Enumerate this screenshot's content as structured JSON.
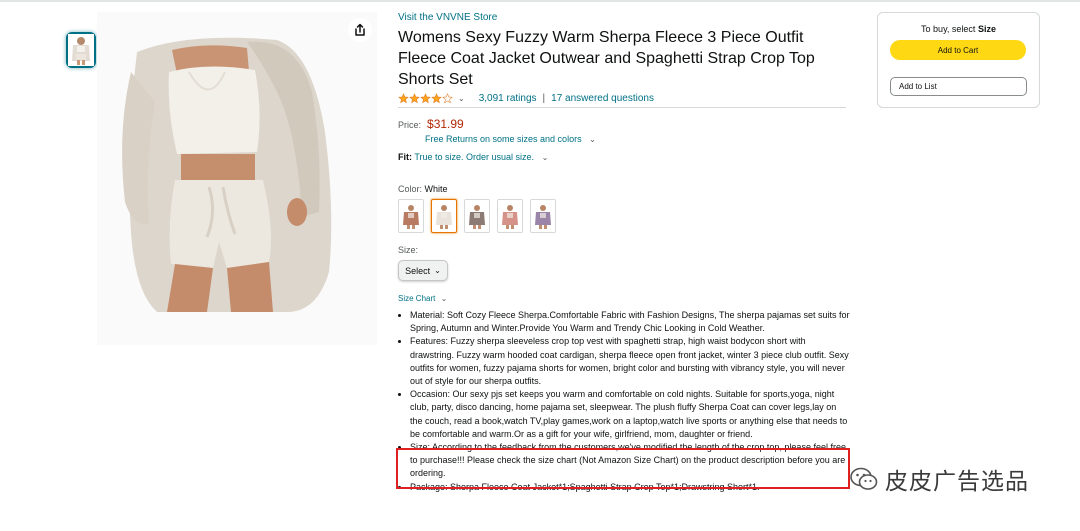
{
  "store_link": "Visit the VNVNE Store",
  "title": "Womens Sexy Fuzzy Warm Sherpa Fleece 3 Piece Outfit Fleece Coat Jacket Outwear and Spaghetti Strap Crop Top Shorts Set",
  "rating": {
    "stars": 4.0,
    "ratings": "3,091 ratings",
    "separator": "|",
    "questions": "17 answered questions"
  },
  "price": {
    "label": "Price:",
    "value": "$31.99",
    "returns": "Free Returns on some sizes and colors"
  },
  "fit": {
    "label": "Fit:",
    "text": "True to size. Order usual size."
  },
  "color": {
    "label": "Color:",
    "value": "White",
    "swatch_colors": [
      "#b97a62",
      "#e9e3dc",
      "#8c7b74",
      "#d49288",
      "#9a85a8"
    ],
    "selected_index": 1
  },
  "size": {
    "label": "Size:",
    "select_value": "Select"
  },
  "size_chart": "Size Chart",
  "bullets": [
    "Material: Soft Cozy Fleece Sherpa.Comfortable Fabric with Fashion Designs, The sherpa pajamas set suits for Spring, Autumn and Winter.Provide You Warm and Trendy Chic Looking in Cold Weather.",
    "Features: Fuzzy sherpa sleeveless crop top vest with spaghetti strap, high waist bodycon short with drawstring. Fuzzy warm hooded coat cardigan, sherpa fleece open front jacket, winter 3 piece club outfit. Sexy outfits for women, fuzzy pajama shorts for women, bright color and bursting with vibrancy style, you will never out of style for our sherpa outfits.",
    "Occasion: Our sexy pjs set keeps you warm and comfortable on cold nights. Suitable for sports,yoga, night club, party, disco dancing, home pajama set, sleepwear. The plush fluffy Sherpa Coat can cover legs,lay on the couch, read a book,watch TV,play games,work on a laptop,watch live sports or anything else that needs to be comfortable and warm.Or as a gift for your wife, girlfriend, mom, daughter or friend.",
    "Size: According to the feedback from the customers,we've modified the length of the crop top, please feel free to purchase!!! Please check the size chart (Not Amazon Size Chart) on the product description before you are ordering.",
    "Package: Sherpa Fleece Coat Jacket*1;Spaghetti Strap Crop Top*1;Drawstring Short*1."
  ],
  "buybox": {
    "prompt": "To buy, select",
    "prompt_bold": "Size",
    "add_to_cart": "Add to Cart",
    "add_to_list": "Add to List"
  },
  "watermark": "皮皮广告选品",
  "colors": {
    "link": "#007185",
    "price": "#B12704",
    "cart_button": "#FFD814",
    "highlight": "#E02020",
    "star": "#FFA41C"
  }
}
